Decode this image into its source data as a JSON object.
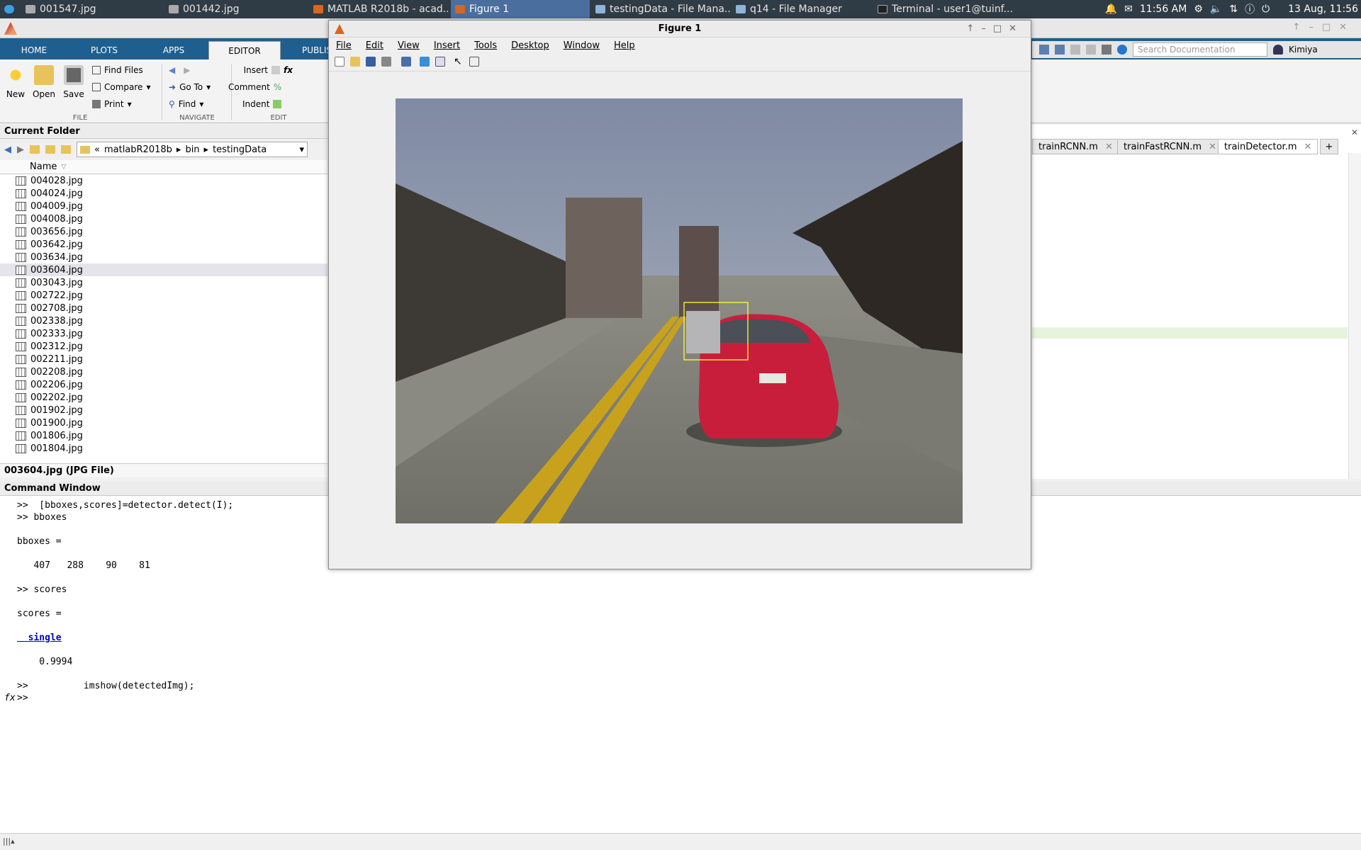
{
  "taskbar": {
    "items": [
      {
        "label": "001547.jpg",
        "icon": "image-icon"
      },
      {
        "label": "001442.jpg",
        "icon": "image-icon"
      },
      {
        "label": "MATLAB R2018b - acad...",
        "icon": "matlab-icon"
      },
      {
        "label": "Figure 1",
        "icon": "matlab-icon"
      },
      {
        "label": "testingData - File Mana...",
        "icon": "folder-icon"
      },
      {
        "label": "q14 - File Manager",
        "icon": "folder-icon"
      },
      {
        "label": "Terminal - user1@tuinf...",
        "icon": "terminal-icon"
      }
    ],
    "clock": "11:56 AM",
    "date": "13 Aug, 11:56"
  },
  "ribbon": {
    "tabs": [
      "HOME",
      "PLOTS",
      "APPS",
      "EDITOR",
      "PUBLIS"
    ],
    "file": {
      "new": "New",
      "open": "Open",
      "save": "Save",
      "find_files": "Find Files",
      "compare": "Compare",
      "print": "Print",
      "group": "FILE"
    },
    "navigate": {
      "go_to": "Go To",
      "find": "Find",
      "group": "NAVIGATE"
    },
    "edit": {
      "insert": "Insert",
      "comment": "Comment",
      "indent": "Indent",
      "group": "EDIT"
    },
    "search_placeholder": "Search Documentation",
    "user": "Kimiya"
  },
  "current_folder": {
    "title": "Current Folder",
    "path": [
      "«",
      "matlabR2018b",
      "bin",
      "testingData"
    ],
    "column": "Name",
    "files": [
      "004028.jpg",
      "004024.jpg",
      "004009.jpg",
      "004008.jpg",
      "003656.jpg",
      "003642.jpg",
      "003634.jpg",
      "003604.jpg",
      "003043.jpg",
      "002722.jpg",
      "002708.jpg",
      "002338.jpg",
      "002333.jpg",
      "002312.jpg",
      "002211.jpg",
      "002208.jpg",
      "002206.jpg",
      "002202.jpg",
      "001902.jpg",
      "001900.jpg",
      "001806.jpg",
      "001804.jpg"
    ],
    "selected_index": 7,
    "details": "003604.jpg  (JPG File)"
  },
  "editor_tabs": [
    "trainRCNN.m",
    "trainFastRCNN.m",
    "trainDetector.m"
  ],
  "command_window": {
    "title": "Command Window",
    "lines": [
      ">>  [bboxes,scores]=detector.detect(I);",
      ">> bboxes",
      "",
      "bboxes =",
      "",
      "   407   288    90    81",
      "",
      ">> scores",
      "",
      "scores =",
      "",
      "  single",
      "",
      "    0.9994",
      "",
      ">>          imshow(detectedImg);",
      ">>"
    ],
    "prompt_symbol": "fx"
  },
  "figure": {
    "title": "Figure 1",
    "menu": [
      "File",
      "Edit",
      "View",
      "Insert",
      "Tools",
      "Desktop",
      "Window",
      "Help"
    ]
  }
}
